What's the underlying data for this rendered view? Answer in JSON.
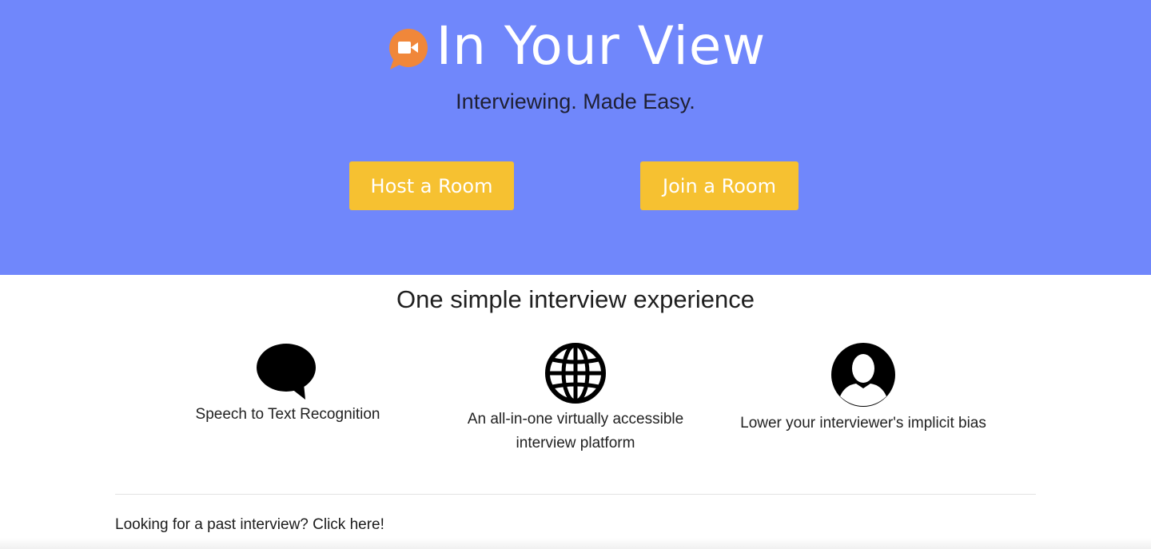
{
  "hero": {
    "app_title": "In Your View",
    "tagline": "Interviewing. Made Easy.",
    "logo_icon": "video-camera-chat-bubble-icon",
    "background_color": "#7087fb",
    "logo_color": "#f0873a",
    "buttons": {
      "host_label": "Host a Room",
      "join_label": "Join a Room",
      "color": "#f6c131"
    }
  },
  "features": {
    "heading": "One simple interview experience",
    "items": [
      {
        "icon": "speech-bubble-icon",
        "text": "Speech to Text Recognition"
      },
      {
        "icon": "globe-icon",
        "text": "An all-in-one virtually accessible interview platform"
      },
      {
        "icon": "user-silhouette-icon",
        "text": "Lower your interviewer's implicit bias"
      }
    ]
  },
  "footer": {
    "past_interview_link": "Looking for a past interview? Click here!"
  }
}
